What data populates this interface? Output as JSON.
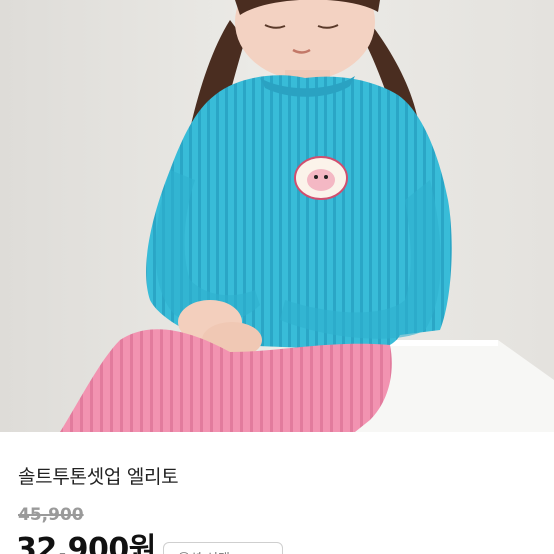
{
  "product": {
    "image_alt": "솔트투톤셋업 엘리토 product photo",
    "title": "솔트투톤셋업 엘리토",
    "original_price": "45,900",
    "sale_price": "32,900원",
    "option_label": "옵션 선택"
  },
  "colors": {
    "sweater": "#35b8d6",
    "pants": "#ef8fae",
    "background": "#e9e7e3"
  }
}
